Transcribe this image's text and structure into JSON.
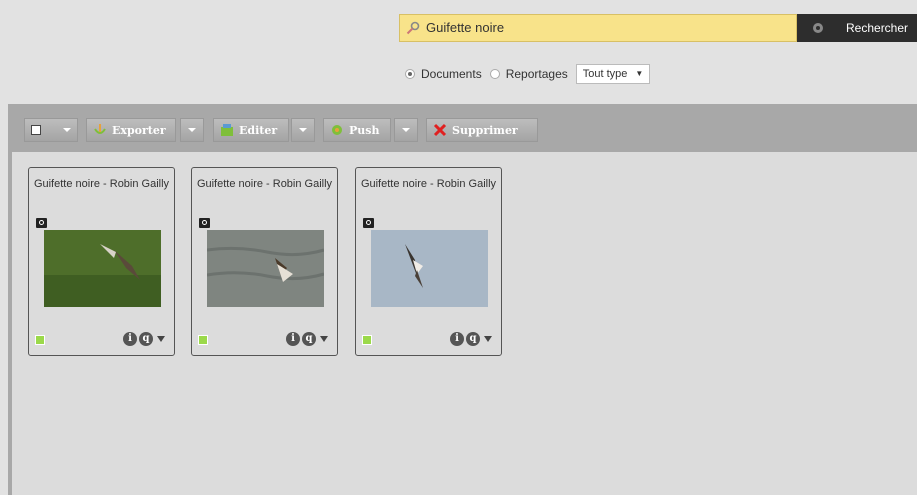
{
  "search": {
    "value": "Guifette noire",
    "button_label": "Rechercher"
  },
  "filters": {
    "options": [
      {
        "label": "Documents",
        "selected": true
      },
      {
        "label": "Reportages",
        "selected": false
      }
    ],
    "type_select": "Tout type"
  },
  "toolbar": {
    "export_label": "Exporter",
    "edit_label": "Editer",
    "push_label": "Push",
    "delete_label": "Supprimer"
  },
  "results": [
    {
      "title": "Guifette noire - Robin Gailly",
      "photo": "bird over green water"
    },
    {
      "title": "Guifette noire - Robin Gailly",
      "photo": "bird over grey water"
    },
    {
      "title": "Guifette noire - Robin Gailly",
      "photo": "bird against blue sky"
    }
  ],
  "colors": {
    "search_bg": "#f8e38a",
    "selected_green": "#9bd94a",
    "delete_red": "#e02020"
  }
}
